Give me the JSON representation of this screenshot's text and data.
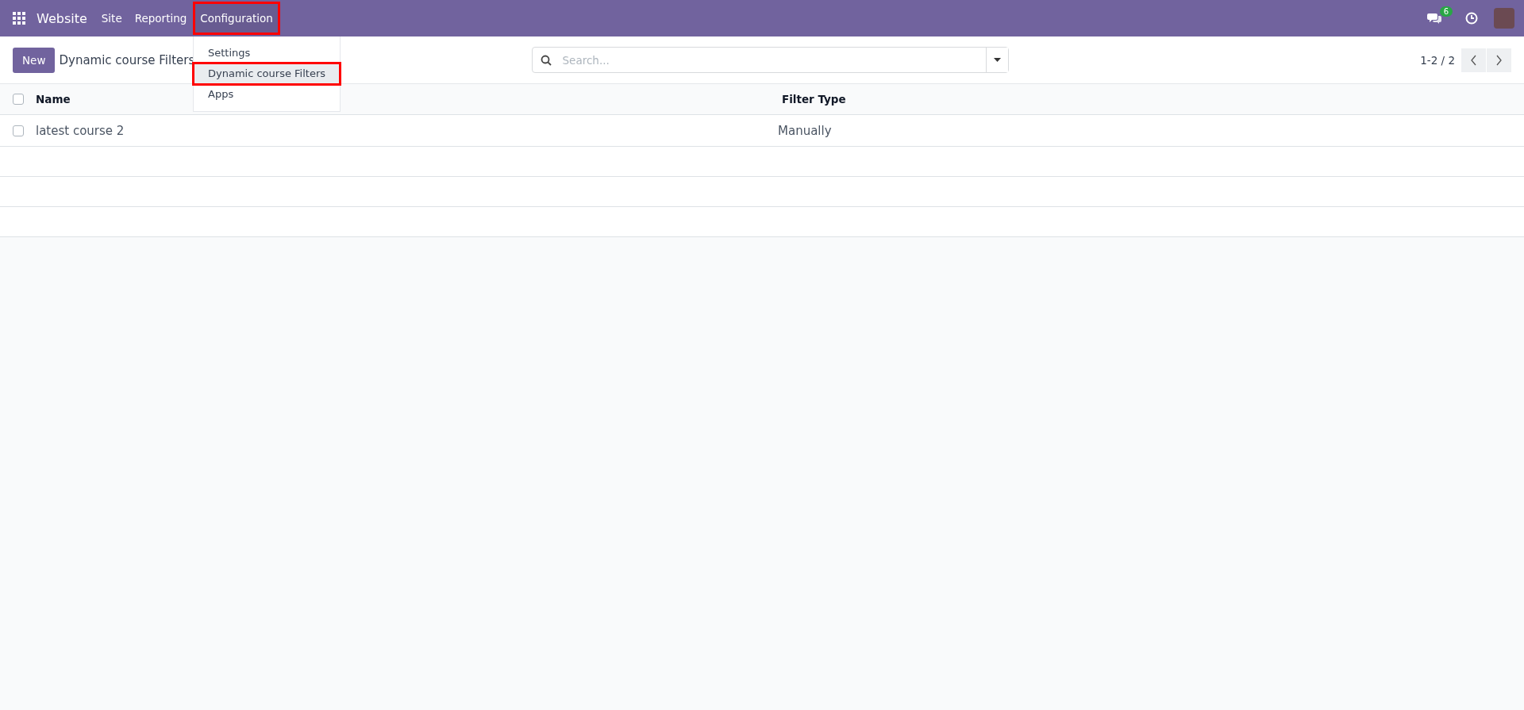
{
  "navbar": {
    "app_name": "Website",
    "menus": [
      {
        "label": "Site",
        "open": false,
        "highlighted": false
      },
      {
        "label": "Reporting",
        "open": false,
        "highlighted": false
      },
      {
        "label": "Configuration",
        "open": true,
        "highlighted": true
      }
    ],
    "messages_count": "6"
  },
  "dropdown": {
    "items": [
      {
        "label": "Settings",
        "active": false,
        "highlighted": false
      },
      {
        "label": "Dynamic course Filters",
        "active": true,
        "highlighted": true
      },
      {
        "label": "Apps",
        "active": false,
        "highlighted": false
      }
    ]
  },
  "control_panel": {
    "new_button": "New",
    "breadcrumb": "Dynamic course Filters",
    "search": {
      "placeholder": "Search..."
    },
    "pager": "1-2 / 2"
  },
  "table": {
    "select_all_checked": false,
    "columns": [
      "Name",
      "Filter Type"
    ],
    "rows": [
      {
        "cells": [
          "latest course 2",
          "Manually"
        ],
        "checked": false
      }
    ]
  }
}
